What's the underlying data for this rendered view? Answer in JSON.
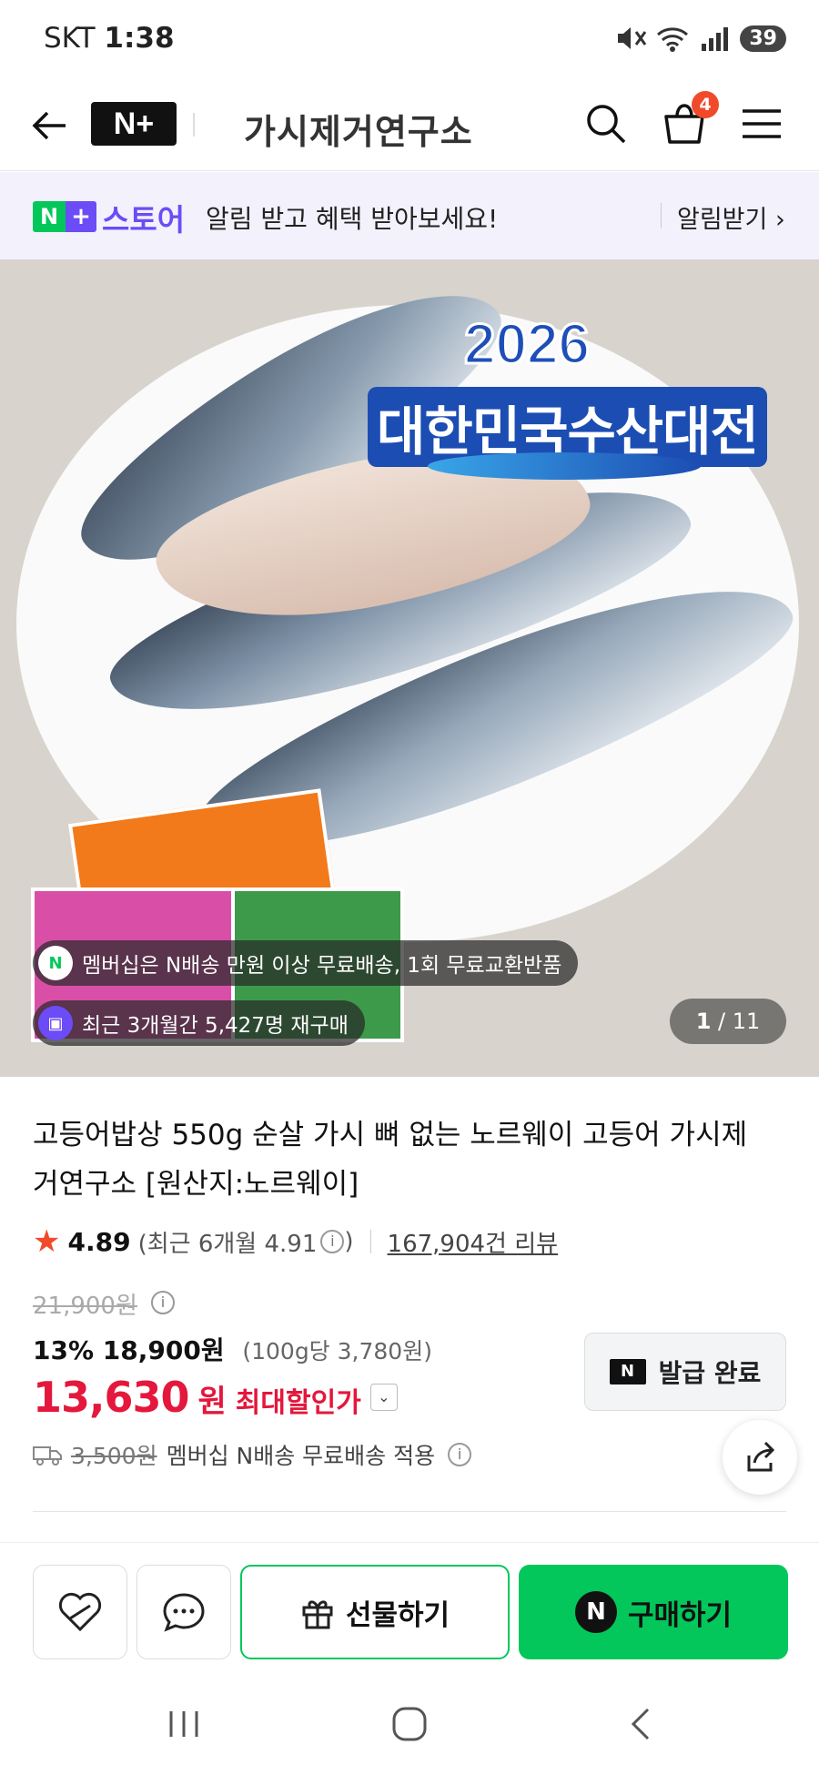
{
  "status": {
    "carrier": "SKT",
    "time": "1:38",
    "battery": "39"
  },
  "header": {
    "brand_badge": "N+",
    "store_logo": "가시제거연구소",
    "cart_count": "4"
  },
  "banner": {
    "store_name": "스토어",
    "message": "알림 받고 혜택 받아보세요!",
    "cta": "알림받기"
  },
  "hero": {
    "promo_year": "2026",
    "promo_title": "대한민국수산대전",
    "benefits": [
      "멤버십은 N배송 만원 이상 무료배송, 1회 무료교환반품",
      "최근 3개월간 5,427명 재구매"
    ],
    "counter_current": "1",
    "counter_total": "/ 11"
  },
  "product": {
    "title": "고등어밥상 550g 순살 가시 뼈 없는 노르웨이 고등어 가시제거연구소 [원산지:노르웨이]",
    "rating": "4.89",
    "rating_recent": "(최근 6개월 4.91",
    "rating_recent_close": ")",
    "reviews": "167,904건 리뷰",
    "original_price": "21,900원",
    "discount_rate": "13%",
    "sale_price": "18,900원",
    "unit_price": "(100g당 3,780원)",
    "max_discount_amount": "13,630",
    "max_discount_won": "원",
    "max_discount_label": "최대할인가",
    "coupon_label": "발급 완료",
    "shipping_fee": "3,500원",
    "shipping_note": "멤버십 N배송 무료배송 적용"
  },
  "actions": {
    "gift_label": "선물하기",
    "buy_label": "구매하기"
  },
  "colors": {
    "naver_green": "#03c75a",
    "nplus_purple": "#6b4cf6",
    "price_red": "#e4173c",
    "badge_orange": "#f04a2b"
  }
}
